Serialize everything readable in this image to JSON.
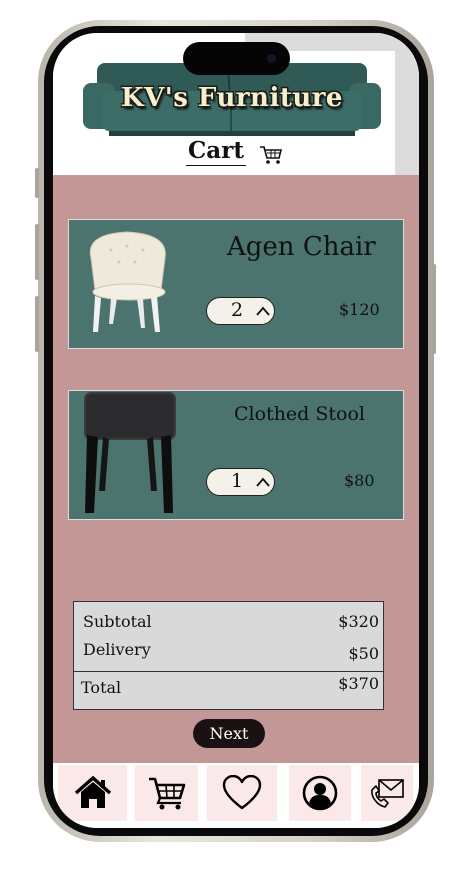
{
  "header": {
    "brand": "KV's Furniture",
    "cart_title": "Cart",
    "icons": [
      "sofa-banner",
      "cart-icon"
    ]
  },
  "cart_items": [
    {
      "name": "Agen Chair",
      "quantity": "2",
      "price": "$120",
      "image": "white-chair"
    },
    {
      "name": "Clothed Stool",
      "quantity": "1",
      "price": "$80",
      "image": "black-stool"
    }
  ],
  "summary": {
    "subtotal_label": "Subtotal",
    "subtotal_value": "$320",
    "delivery_label": "Delivery",
    "delivery_value": "$50",
    "total_label": "Total",
    "total_value": "$370"
  },
  "next_label": "Next",
  "nav": {
    "icons": [
      "home-icon",
      "cart-icon",
      "heart-icon",
      "profile-icon",
      "contact-icon"
    ]
  },
  "colors": {
    "background_pink": "#c29796",
    "card_teal": "#4a746d",
    "summary_gray": "#d9d9d9",
    "nav_item_pink": "#fbe9e9",
    "next_button": "#1a1212",
    "brand_text": "#f6efc8"
  }
}
